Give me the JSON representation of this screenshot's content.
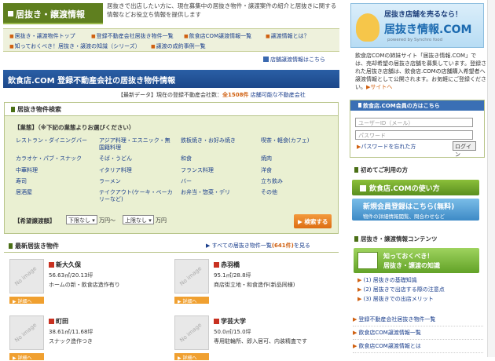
{
  "header": {
    "title": "居抜き・譲渡情報",
    "intro": "居抜きで出店したい方に、現在募集中の居抜き物件・譲渡案件の紹介と居抜きに関する情報などお役立ち情報を提供します"
  },
  "nav": [
    "居抜き・譲渡物件トップ",
    "登録不動産会社居抜き物件一覧",
    "飲食店COM譲渡情報一覧",
    "譲渡情報とは？",
    "知っておくべき！居抜き・譲渡の知識（シリーズ）",
    "譲渡の成約事例一覧"
  ],
  "keep_note": "店舗譲渡情報はこちら",
  "main_heading": "飲食店.COM 登録不動産会社の居抜き物件情報",
  "latest": {
    "label": "【最新データ】現在の登録不動産会社数：",
    "count": "全1508件",
    "link": "店舗可能な不動産会社"
  },
  "search": {
    "title": "居抜き物件検索",
    "cond1": "【業態】（※下記の業態よりお選びください）",
    "categories": [
      "レストラン・ダイニングバー",
      "アジア料理・エスニック・無国籍料理",
      "鉄板焼き・お好み焼き",
      "喫茶・軽食(カフェ)",
      "カラオケ・パブ・スナック",
      "そば・うどん",
      "和食",
      "焼肉",
      "中華料理",
      "イタリア料理",
      "フランス料理",
      "洋食",
      "寿司",
      "ラーメン",
      "バー",
      "立ち飲み",
      "居酒屋",
      "テイクアウト(ケーキ・ベーカリーなど)",
      "お弁当・惣菜・デリ",
      "その他"
    ],
    "cond2": "【希望譲渡額】",
    "min_value": "下限なし",
    "max_value": "上限なし",
    "unit_from": "万円〜",
    "unit_to": "万円",
    "button": "▶ 検索する"
  },
  "listings": {
    "title": "最新居抜き物件",
    "all_link_prefix": "▶ すべての居抜き物件一覧",
    "all_link_count": "(641件)",
    "all_link_suffix": "を見る",
    "no_image": "No image",
    "detail_label": "▶ 詳細へ",
    "items": [
      {
        "name": "新大久保",
        "area": "56.63㎡/20.13坪",
        "desc": "ホームの新・飲食店造作有り"
      },
      {
        "name": "赤羽橋",
        "area": "95.1㎡/28.8坪",
        "desc": "商店街立地・和食造作(新品同様)"
      },
      {
        "name": "町田",
        "area": "38.61㎡/11.68坪",
        "desc": "スナック造作つき"
      },
      {
        "name": "学芸大学",
        "area": "50.0㎡/15.0坪",
        "desc": "専用駐輪所、即入居可、内装精査です"
      }
    ]
  },
  "right": {
    "banner_title": "居抜き店舗を売るなら！",
    "banner_logo": "居抜き情報.COM",
    "banner_sub": "powered by Synchro food",
    "about": "飲食店COMの姉妹サイト「居抜き情報.COM」では、売却希望の居抜き店舗を募集しています。登録された居抜き店舗は、飲食店.COMの店舗購入希望者へ譲渡情報として公開されます。お気軽にご登録ください。",
    "about_more": "▶サイトへ",
    "member_head": "飲食店.COM会員の方はこちら",
    "user_placeholder": "ユーザーID（メール）",
    "pw_placeholder": "パスワード",
    "forgot": "パスワードを忘れた方",
    "login": "ログイン",
    "first_head": "初めてご利用の方",
    "guide": "飲食店.COMの使い方",
    "register_t1": "新規会員登録はこちら(無料)",
    "register_t2": "物件の詳細情報閲覧、問合わせなど",
    "content_head": "居抜き・譲渡情報コンテンツ",
    "knowledge_t1": "知っておくべき！",
    "knowledge_t2": "居抜き・譲渡の知識",
    "knowledge_links": [
      "(1) 居抜きの基礎知識",
      "(2) 居抜きで出店する際の注意点",
      "(3) 居抜きでの出店メリット"
    ],
    "links": [
      "登録不動産会社居抜き物件一覧",
      "飲食店COM譲渡情報一覧",
      "飲食店COM譲渡情報とは"
    ]
  }
}
